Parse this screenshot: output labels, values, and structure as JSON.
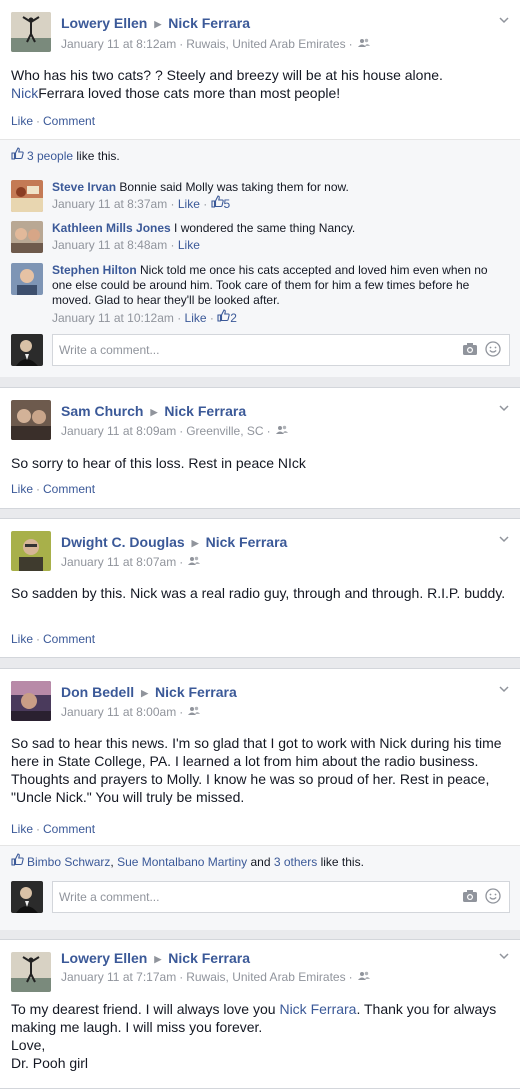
{
  "posts": [
    {
      "author": "Lowery Ellen",
      "target": "Nick Ferrara",
      "time": "January 11 at 8:12am",
      "location": "Ruwais, United Arab Emirates",
      "text_parts": [
        "Who has his two cats? ? Steely and breezy will be at his house alone. ",
        "Nick",
        "Ferrara loved those cats more than most people!"
      ],
      "actions": {
        "like": "Like",
        "comment": "Comment"
      },
      "likes": {
        "count_link": "3 people",
        "suffix": "like this."
      },
      "comments": [
        {
          "author": "Steve Irvan",
          "text": "Bonnie said Molly was taking them for now.",
          "time": "January 11 at 8:37am",
          "like": "Like",
          "likes": "5"
        },
        {
          "author": "Kathleen Mills Jones",
          "text": "I wondered the same thing Nancy.",
          "time": "January 11 at 8:48am",
          "like": "Like",
          "likes": ""
        },
        {
          "author": "Stephen Hilton",
          "text": "Nick told me once his cats accepted and loved him even when no one else could be around him. Took care of them for him a few times before he moved. Glad to hear they'll be looked after.",
          "time": "January 11 at 10:12am",
          "like": "Like",
          "likes": "2"
        }
      ],
      "write_placeholder": "Write a comment..."
    },
    {
      "author": "Sam Church",
      "target": "Nick Ferrara",
      "time": "January 11 at 8:09am",
      "location": "Greenville, SC",
      "text": "So sorry to hear of this loss. Rest in peace NIck",
      "actions": {
        "like": "Like",
        "comment": "Comment"
      }
    },
    {
      "author": "Dwight C. Douglas",
      "target": "Nick Ferrara",
      "time": "January 11 at 8:07am",
      "location": "",
      "text": "So sadden by this. Nick was a real radio guy, through and through. R.I.P. buddy.",
      "actions": {
        "like": "Like",
        "comment": "Comment"
      }
    },
    {
      "author": "Don Bedell",
      "target": "Nick Ferrara",
      "time": "January 11 at 8:00am",
      "location": "",
      "text": "So sad to hear this news. I'm so glad that I got to work with Nick during his time here in State College, PA. I learned a lot from him about the radio business. Thoughts and prayers to Molly. I know he was so proud of her. Rest in peace, \"Uncle Nick.\" You will truly be missed.",
      "actions": {
        "like": "Like",
        "comment": "Comment"
      },
      "likes": {
        "name1": "Bimbo Schwarz",
        "comma": ",",
        "name2": "Sue Montalbano Martiny",
        "and": "and",
        "others": "3 others",
        "suffix": "like this."
      },
      "write_placeholder": "Write a comment..."
    },
    {
      "author": "Lowery Ellen",
      "target": "Nick Ferrara",
      "time": "January 11 at 7:17am",
      "location": "Ruwais, United Arab Emirates",
      "text_parts": [
        "To my dearest friend. I will always love you ",
        "Nick Ferrara",
        ". Thank you for always making me laugh. I will miss you forever."
      ],
      "signoff1": "Love,",
      "signoff2": "Dr. Pooh girl"
    }
  ],
  "colors": {
    "link": "#3b5998",
    "meta": "#90949c",
    "background": "#e9eaed"
  }
}
